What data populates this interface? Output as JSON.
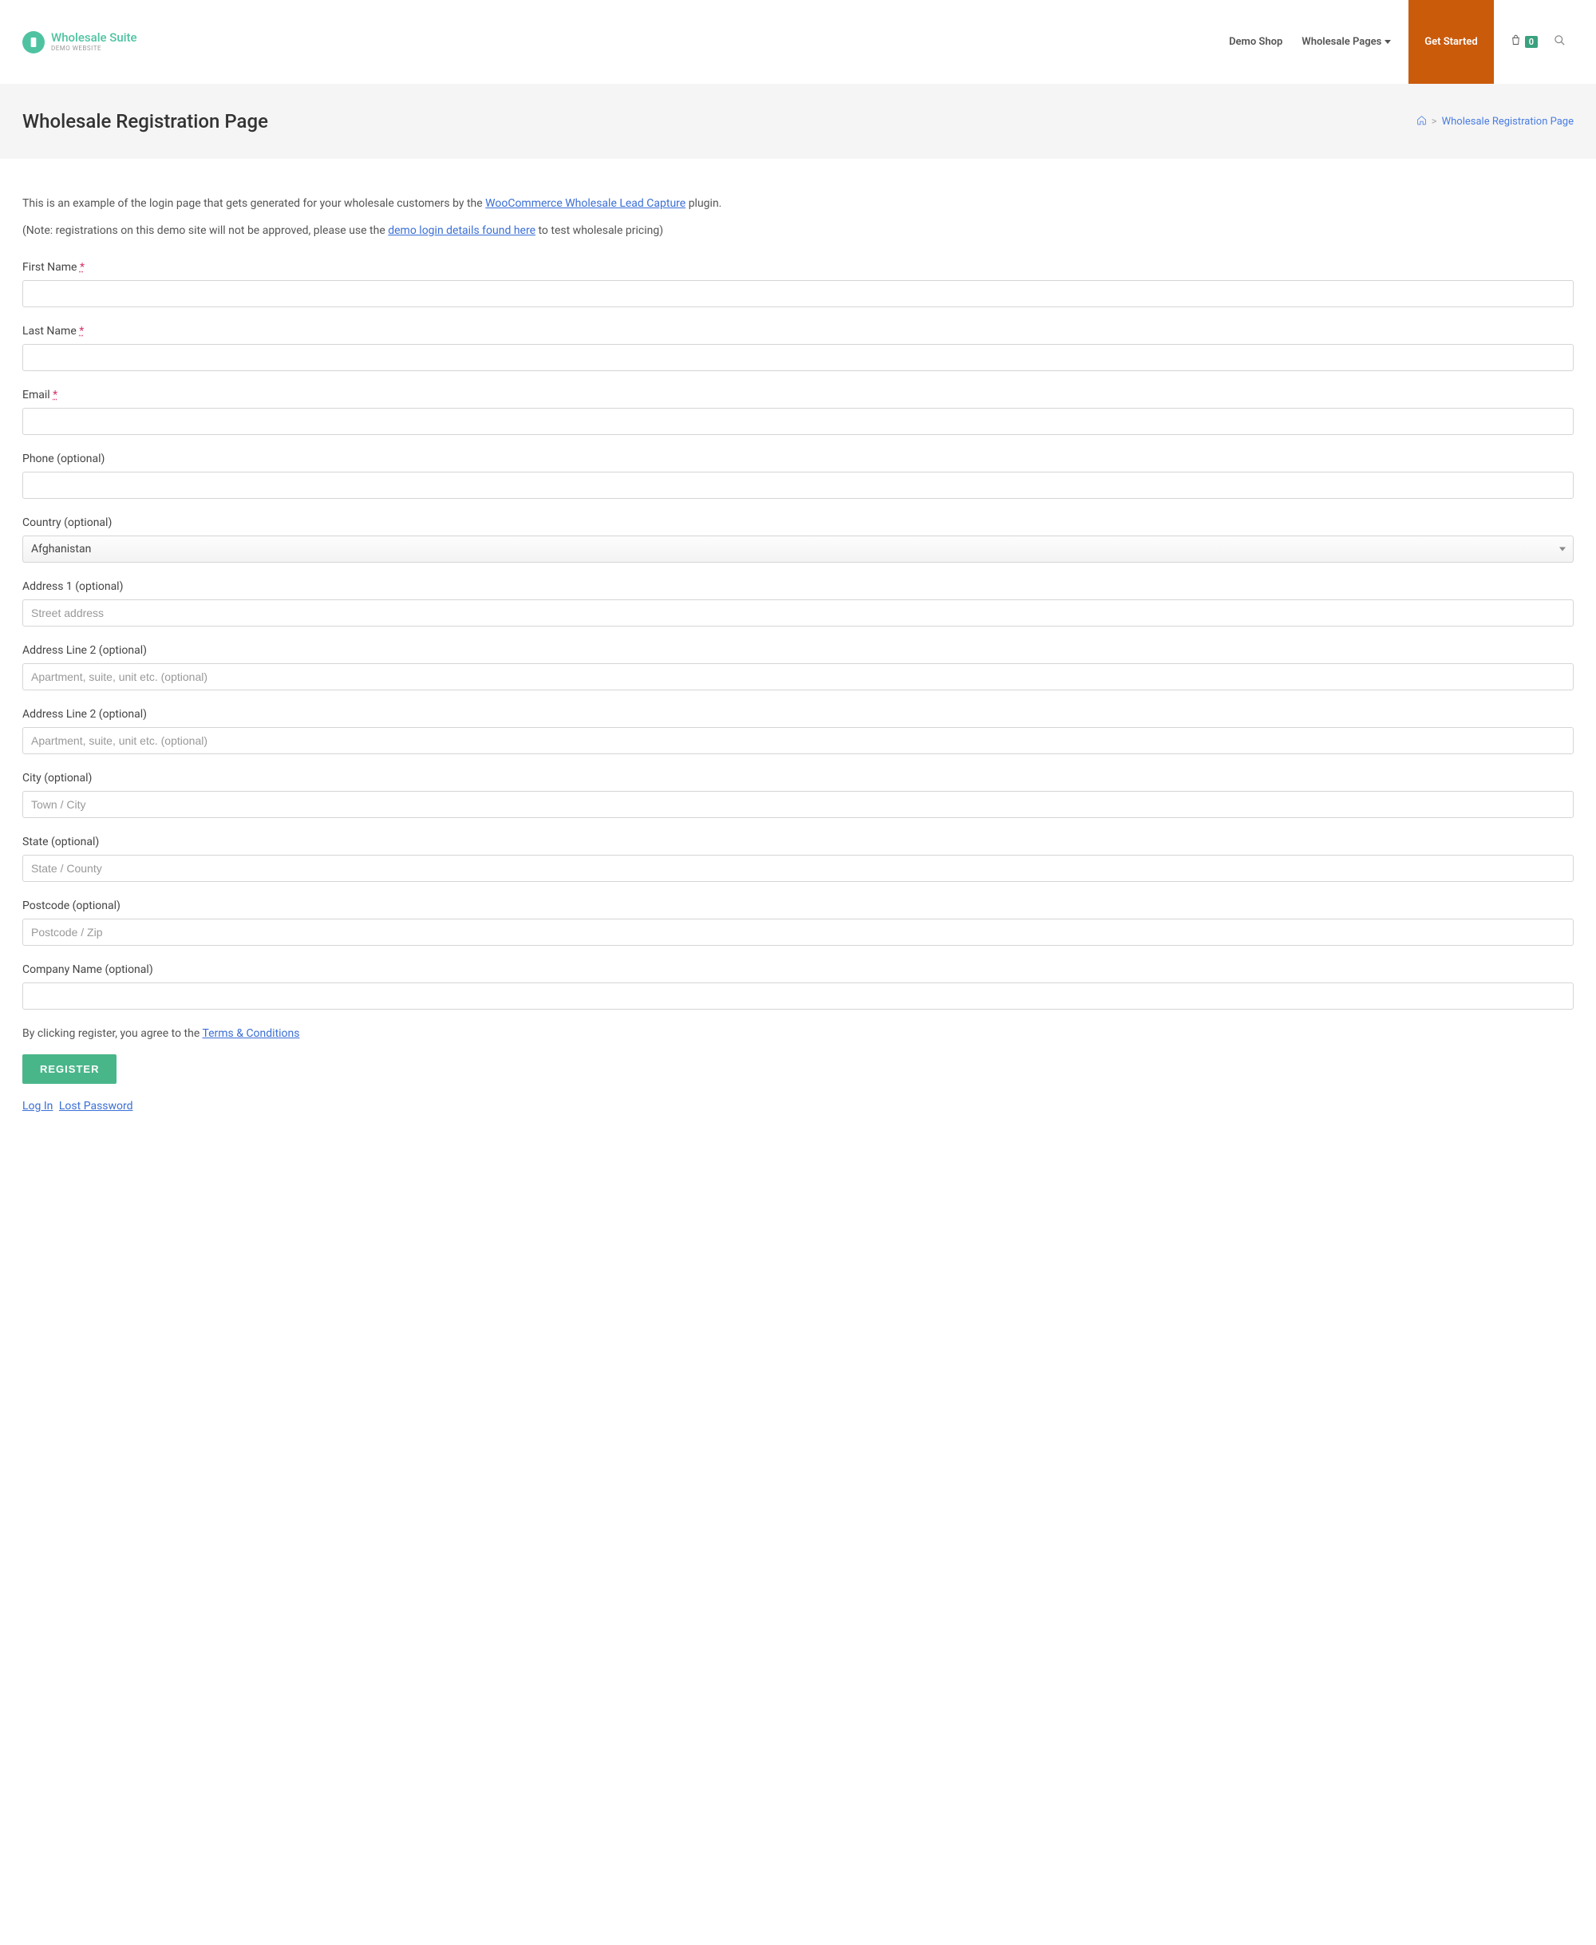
{
  "logo": {
    "title": "Wholesale Suite",
    "subtitle": "DEMO WEBSITE"
  },
  "nav": {
    "demo_shop": "Demo Shop",
    "wholesale_pages": "Wholesale Pages",
    "get_started": "Get Started",
    "cart_count": "0"
  },
  "page_header": {
    "title": "Wholesale Registration Page",
    "breadcrumb_current": "Wholesale Registration Page"
  },
  "intro": {
    "text_before": "This is an example of the login page that gets generated for your wholesale customers by the ",
    "link": "WooCommerce Wholesale Lead Capture",
    "text_after": " plugin."
  },
  "note": {
    "text_before": "(Note: registrations on this demo site will not be approved, please use the ",
    "link": "demo login details found here",
    "text_after": " to test wholesale pricing)"
  },
  "fields": {
    "first_name": {
      "label": "First Name ",
      "required": "*"
    },
    "last_name": {
      "label": "Last Name ",
      "required": "*"
    },
    "email": {
      "label": "Email ",
      "required": "*"
    },
    "phone": {
      "label": "Phone (optional)"
    },
    "country": {
      "label": "Country (optional)",
      "selected": "Afghanistan"
    },
    "address_1": {
      "label": "Address 1 (optional)",
      "placeholder": "Street address"
    },
    "address_line_2a": {
      "label": "Address Line 2 (optional)",
      "placeholder": "Apartment, suite, unit etc. (optional)"
    },
    "address_line_2b": {
      "label": "Address Line 2 (optional)",
      "placeholder": "Apartment, suite, unit etc. (optional)"
    },
    "city": {
      "label": "City (optional)",
      "placeholder": "Town / City"
    },
    "state": {
      "label": "State (optional)",
      "placeholder": "State / County"
    },
    "postcode": {
      "label": "Postcode (optional)",
      "placeholder": "Postcode / Zip"
    },
    "company_name": {
      "label": "Company Name (optional)"
    }
  },
  "terms": {
    "text_before": "By clicking register, you agree to the ",
    "link": "Terms & Conditions"
  },
  "register_button": "REGISTER",
  "aux_links": {
    "log_in": "Log In",
    "lost_password": "Lost Password"
  }
}
